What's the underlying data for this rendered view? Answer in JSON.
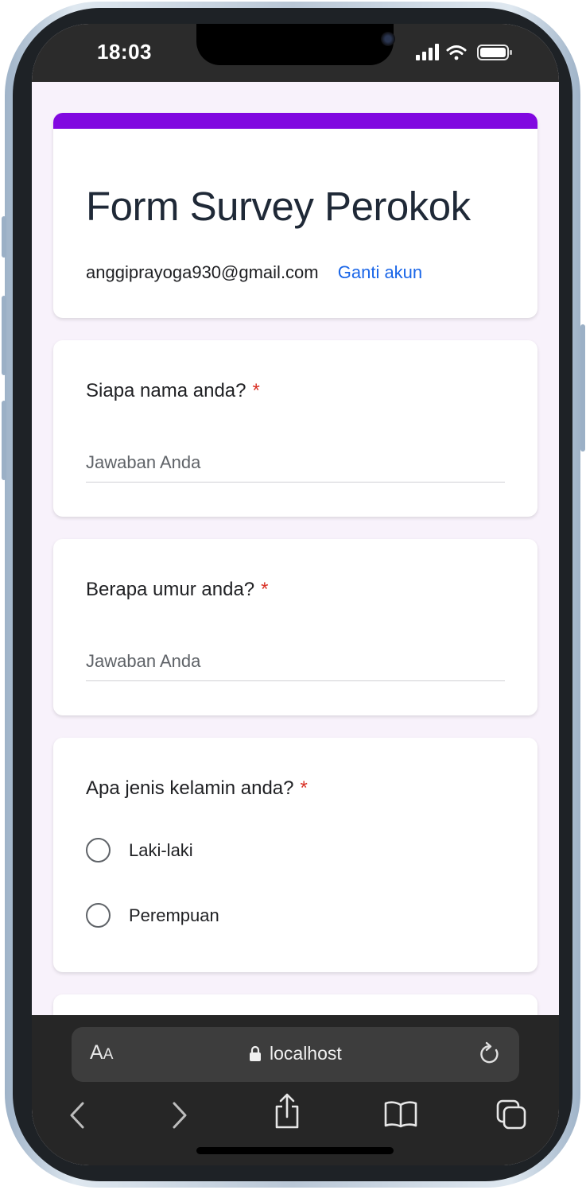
{
  "status_bar": {
    "time": "18:03"
  },
  "form": {
    "title": "Form Survey Perokok",
    "account_email": "anggiprayoga930@gmail.com",
    "switch_account_label": "Ganti akun",
    "accent_color": "#8108e0"
  },
  "questions": [
    {
      "label": "Siapa nama anda?",
      "required_mark": "*",
      "placeholder": "Jawaban Anda",
      "value": ""
    },
    {
      "label": "Berapa umur anda?",
      "required_mark": "*",
      "placeholder": "Jawaban Anda",
      "value": ""
    },
    {
      "label": "Apa jenis kelamin anda?",
      "required_mark": "*",
      "options": [
        "Laki-laki",
        "Perempuan"
      ]
    }
  ],
  "browser": {
    "text_size_label_big": "A",
    "text_size_label_small": "A",
    "url": "localhost",
    "icons": [
      "lock-icon",
      "reload-icon",
      "back-icon",
      "forward-icon",
      "share-icon",
      "bookmarks-icon",
      "tabs-icon"
    ]
  }
}
